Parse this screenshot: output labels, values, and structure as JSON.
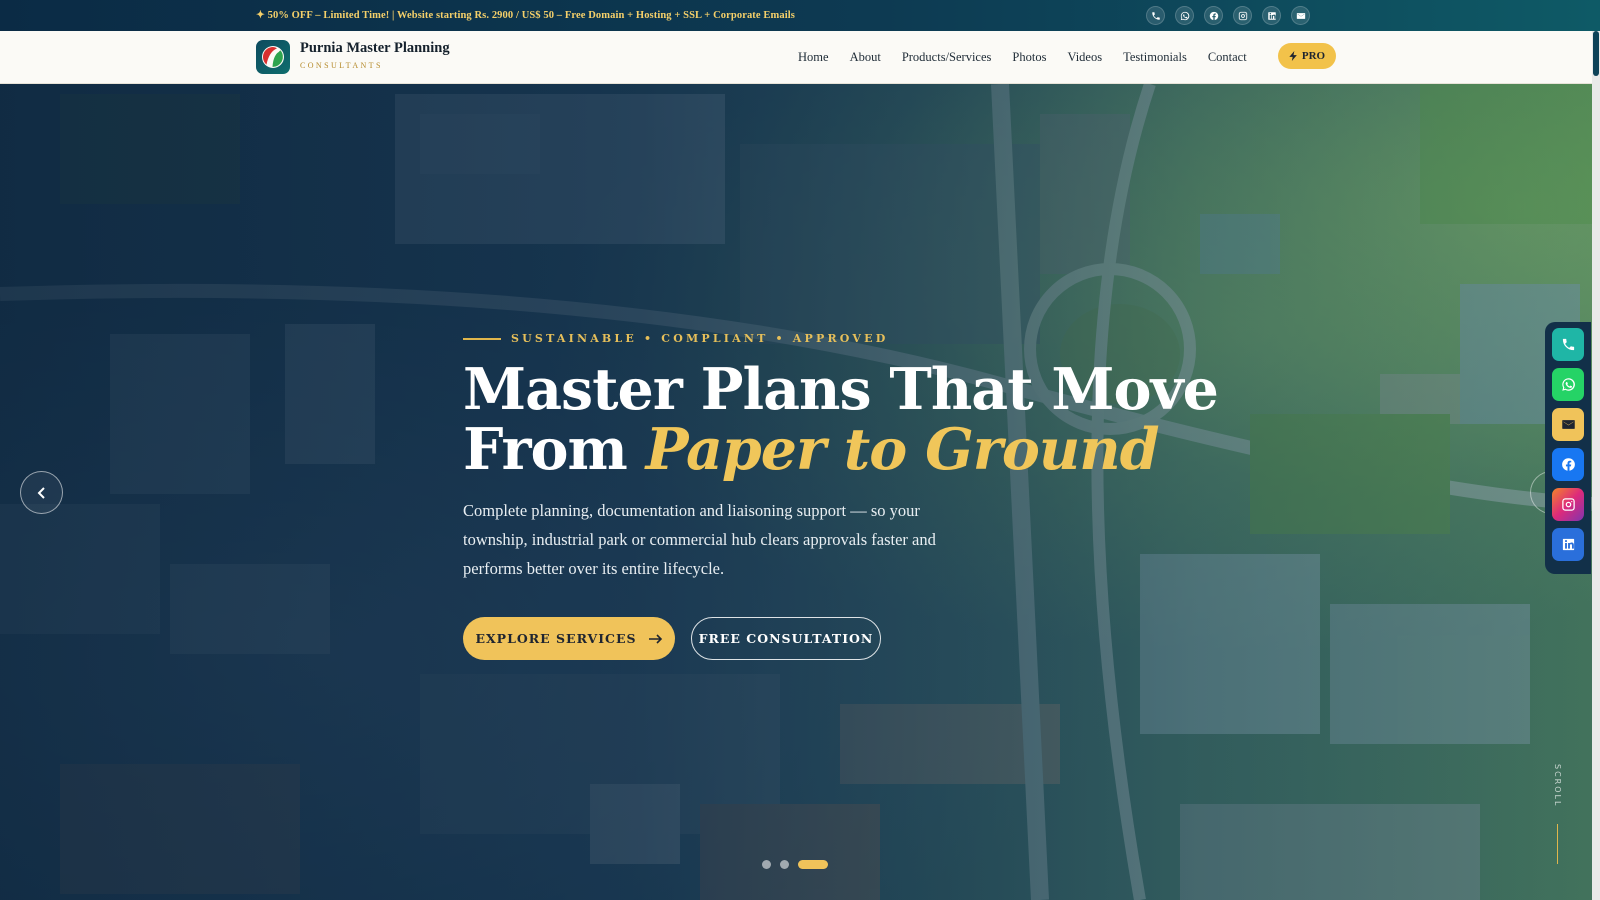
{
  "promo": {
    "text": "✦ 50% OFF – Limited Time! | Website starting Rs. 2900 / US$ 50 – Free Domain + Hosting + SSL + Corporate Emails",
    "social_icons": [
      "phone-icon",
      "whatsapp-icon",
      "facebook-icon",
      "instagram-icon",
      "linkedin-icon",
      "mail-icon"
    ]
  },
  "brand": {
    "name": "Purnia Master Planning",
    "subtitle": "CONSULTANTS"
  },
  "nav": {
    "items": [
      "Home",
      "About",
      "Products/Services",
      "Photos",
      "Videos",
      "Testimonials",
      "Contact"
    ],
    "pro_label": "PRO"
  },
  "hero": {
    "eyebrow": "SUSTAINABLE • COMPLIANT • APPROVED",
    "title_line1": "Master Plans That Move",
    "title_line2_prefix": "From ",
    "title_line2_accent": "Paper to Ground",
    "lede": "Complete planning, documentation and liaisoning support — so your township, industrial park or commercial hub clears approvals faster and performs better over its entire lifecycle.",
    "primary_cta": "EXPLORE SERVICES",
    "secondary_cta": "FREE CONSULTATION",
    "slides_total": 3,
    "active_slide": 3,
    "scroll_label": "SCROLL"
  },
  "floating_social": [
    {
      "name": "phone-icon",
      "color": "#1fb6a6"
    },
    {
      "name": "whatsapp-icon",
      "color": "#25d366"
    },
    {
      "name": "mail-icon",
      "color": "#f0c35a"
    },
    {
      "name": "facebook-icon",
      "color": "#1877f2"
    },
    {
      "name": "instagram-icon",
      "color": "#e1306c"
    },
    {
      "name": "linkedin-icon",
      "color": "#2a6fdb"
    }
  ],
  "colors": {
    "accent_gold": "#f0c35a",
    "navy": "#0d2b45",
    "teal": "#0e5a66"
  }
}
